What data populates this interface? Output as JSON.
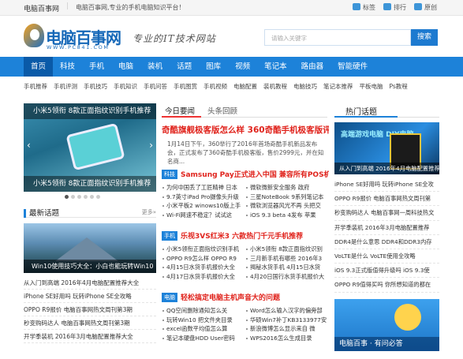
{
  "topbar": {
    "site": "电脑百事网",
    "slogan": "电脑百事网,专业的手机电脑知识平台！",
    "links": [
      "标签",
      "排行",
      "原创"
    ]
  },
  "header": {
    "logo_name": "电脑百事网",
    "logo_url": "WWW.PC841.COM",
    "tagline": "专业的IT技术网站",
    "search_placeholder": "请输入关键字",
    "search_button": "搜索"
  },
  "nav": [
    "首页",
    "科技",
    "手机",
    "电脑",
    "装机",
    "话题",
    "图库",
    "视频",
    "笔记本",
    "路由器",
    "智能硬件"
  ],
  "subnav": [
    "手机推荐",
    "手机评测",
    "手机技巧",
    "手机知识",
    "手机问答",
    "手机图赏",
    "手机视频",
    "电脑配置",
    "装机教程",
    "电脑技巧",
    "笔记本推荐",
    "平板电脑",
    "Ps教程"
  ],
  "slider": {
    "caption_top": "小米5领衔 8款正面指纹识别手机推荐",
    "caption_bottom": "小米5领衔 8款正面指纹识别手机推荐"
  },
  "latest": {
    "title": "最新话题",
    "more": "更多»",
    "image_caption": "Win10使用技巧大全：小白也能玩转Win10",
    "items": [
      "从入门到高端 2016年4月电脑配置推荐大全",
      "iPhone SE好用吗 玩转iPhone SE全攻略",
      "OPPO R9报价 电脑百事网热文周刊第3期",
      "秒变购码达人 电脑百事网热文周刊第3期",
      "开学季装机 2016年3月电脑配置推荐大全"
    ]
  },
  "middle": {
    "tabs": [
      "今日要闻",
      "头条回顾"
    ],
    "headline": "奇酷旗舰极客版怎么样 360奇酷手机极客版评测...",
    "summary": "1月14日下午，360举行了2016年首场奇酷手机新品发布会，正式发布了360奇酷手机极客版，售价2999元，并在知名商...",
    "sections": [
      {
        "tag": "科技",
        "title": "Samsung Pay正式进入中国 兼容所有POS机",
        "items": [
          "为何中国丢了工匠精神 日本",
          "微软微新安全服务 政府",
          "9.7英寸iPad Pro摄像头升级",
          "三星NoteBook 9系列笔记本",
          "小米平板2 winows10版上手",
          "微软浏览器风光不再 头把交",
          "Wi-Fi网速不稳定？试试这",
          "iOS 9.3 beta 4发布 苹果"
        ]
      },
      {
        "tag": "手机",
        "title": "乐视3VS红米3 六款热门千元手机推荐",
        "items": [
          "小米5领衔正面指纹识别手机",
          "小米5领衔 8款正面指纹识别",
          "OPPO R9怎么样 OPPO R9",
          "三月新手机有哪些 2016年3",
          "4月15日水货手机报价大全",
          "揭秘水货手机 4月15日水货",
          "4月17日水货手机报价大全",
          "4月20日国行水货手机报价大"
        ]
      },
      {
        "tag": "电脑",
        "title": "轻松搞定电脑主机声音大的问题",
        "items": [
          "QQ空间删除通知怎么关",
          "Word怎么输入汉字的偏旁部",
          "玩转Win10 把文件夹目录",
          "华硕Win7补丁KB3133977安",
          "excel函数平均值怎么算",
          "新浪微博怎么显示来自 微",
          "笔记本硬盘HDD User密码",
          "WPS2016怎么生成目录"
        ]
      }
    ]
  },
  "right": {
    "title": "热门话题",
    "banner_title": "高端游戏电脑 DIY电脑",
    "banner_caption": "从入门到高端 2016年4月电脑配置推荐",
    "items": [
      "iPhone SE好用吗 玩转iPhone SE全攻",
      "OPPO R9报价 电脑百事网热文周刊第",
      "秒变购码达人 电脑百事网一周科技热文",
      "开学季装机 2016年3月电脑配置推荐",
      "DDR4是什么意思 DDR4和DDR3内存",
      "VoLTE是什么 VoLTE使用全攻略",
      "iOS 9.3正式版值得升级吗 iOS 9.3使",
      "OPPO R9值得买吗 你所想知道的都在"
    ],
    "ad_caption": "电脑百事 · 有问必答"
  }
}
